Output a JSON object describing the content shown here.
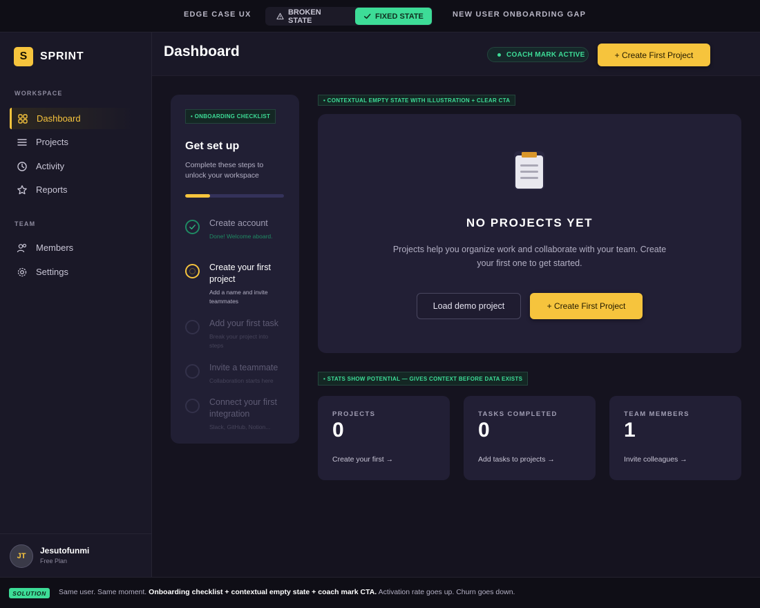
{
  "topbar": {
    "left_label": "EDGE CASE UX",
    "right_label": "NEW USER ONBOARDING GAP",
    "toggle": {
      "broken_label": "BROKEN STATE",
      "fixed_label": "FIXED STATE",
      "selected": "FIXED STATE"
    }
  },
  "brand": {
    "mark": "S",
    "name": "SPRINT"
  },
  "sidebar": {
    "workspace_label": "WORKSPACE",
    "team_label": "TEAM",
    "workspace_items": [
      {
        "label": "Dashboard",
        "icon": "grid-icon",
        "active": true
      },
      {
        "label": "Projects",
        "icon": "list-icon"
      },
      {
        "label": "Activity",
        "icon": "clock-icon"
      },
      {
        "label": "Reports",
        "icon": "star-icon"
      }
    ],
    "team_items": [
      {
        "label": "Members",
        "icon": "users-icon"
      },
      {
        "label": "Settings",
        "icon": "gear-icon"
      }
    ]
  },
  "user": {
    "initials": "JT",
    "name": "Jesutofunmi",
    "plan": "Free Plan"
  },
  "header": {
    "title": "Dashboard",
    "coach_label": "COACH MARK ACTIVE",
    "cta_label": "+ Create First Project"
  },
  "checklist": {
    "tag": "• ONBOARDING CHECKLIST",
    "title": "Get set up",
    "subtitle": "Complete these steps to unlock your workspace",
    "progress_fraction": 0.25,
    "steps": [
      {
        "title": "Create account",
        "desc": "Done! Welcome aboard.",
        "state": "done"
      },
      {
        "title": "Create your first project",
        "desc": "Add a name and invite teammates",
        "state": "current"
      },
      {
        "title": "Add your first task",
        "desc": "Break your project into steps",
        "state": "pending"
      },
      {
        "title": "Invite a teammate",
        "desc": "Collaboration starts here",
        "state": "pending"
      },
      {
        "title": "Connect your first integration",
        "desc": "Slack, GitHub, Notion...",
        "state": "pending"
      }
    ]
  },
  "empty_state": {
    "tag": "• CONTEXTUAL EMPTY STATE WITH ILLUSTRATION + CLEAR CTA",
    "illustration": "clipboard-icon",
    "title": "NO PROJECTS YET",
    "description": "Projects help you organize work and collaborate with your team. Create your first one to get started.",
    "secondary_label": "Load demo project",
    "primary_label": "+ Create First Project"
  },
  "stats": {
    "tag": "• STATS SHOW POTENTIAL — GIVES CONTEXT BEFORE DATA EXISTS",
    "cards": [
      {
        "label": "PROJECTS",
        "value": "0",
        "link": "Create your first →"
      },
      {
        "label": "TASKS COMPLETED",
        "value": "0",
        "link": "Add tasks to projects →"
      },
      {
        "label": "TEAM MEMBERS",
        "value": "1",
        "link": "Invite colleagues →"
      }
    ]
  },
  "footer": {
    "badge": "SOLUTION",
    "lead": "Same user. Same moment.",
    "emphasis": "Onboarding checklist + contextual empty state + coach mark CTA.",
    "tail": "Activation rate goes up. Churn goes down."
  },
  "colors": {
    "accent": "#f6c43d",
    "success": "#3ddc97",
    "background": "#15131f",
    "card": "#221f35"
  }
}
